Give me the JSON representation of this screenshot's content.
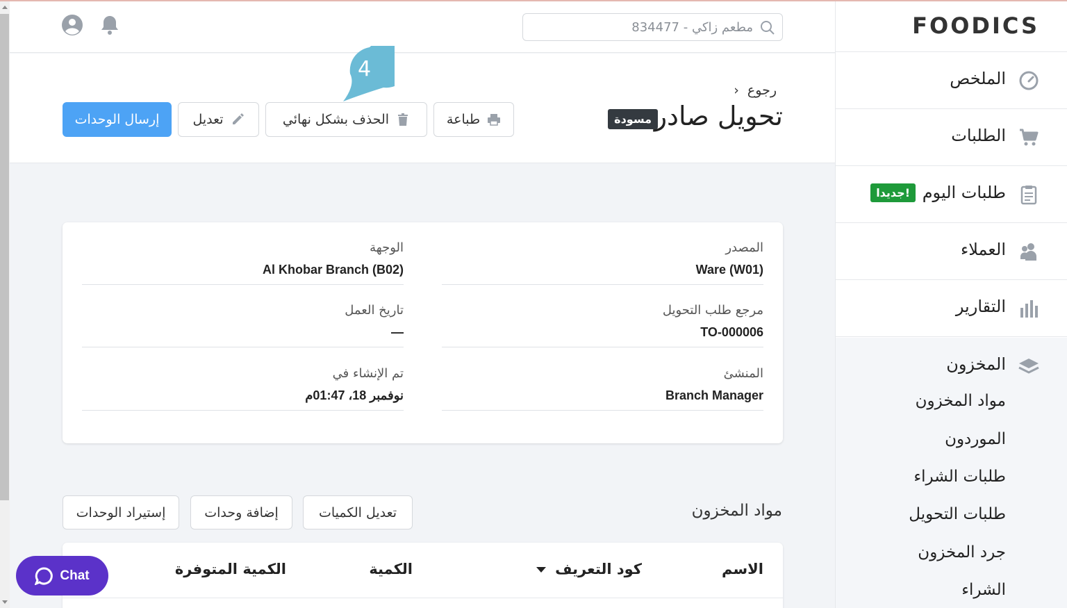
{
  "brand": {
    "logo": "FOODICS"
  },
  "header": {
    "search_text": "مطعم زاكي - 834477"
  },
  "sidebar": {
    "items": [
      {
        "label": "الملخص",
        "icon": "dashboard-gauge-icon"
      },
      {
        "label": "الطلبات",
        "icon": "cart-icon"
      },
      {
        "label": "طلبات اليوم",
        "icon": "clipboard-icon",
        "badge": "جديدا!"
      },
      {
        "label": "العملاء",
        "icon": "users-icon"
      },
      {
        "label": "التقارير",
        "icon": "bar-chart-icon"
      }
    ],
    "inventory": {
      "label": "المخزون",
      "icon": "layers-icon",
      "sub_items": [
        "مواد المخزون",
        "الموردون",
        "طلبات الشراء",
        "طلبات التحويل",
        "جرد المخزون",
        "الشراء"
      ]
    }
  },
  "page": {
    "back": "رجوع",
    "title": "تحويل صادر",
    "status_badge": "مسودة",
    "step_number": "4",
    "buttons": {
      "print": "طباعة",
      "delete": "الحذف بشكل نهائي",
      "edit": "تعديل",
      "send": "إرسال الوحدات"
    }
  },
  "details": {
    "source_label": "المصدر",
    "source_value": "Ware (W01)",
    "destination_label": "الوجهة",
    "destination_value": "Al Khobar Branch (B02)",
    "reference_label": "مرجع طلب التحويل",
    "reference_value": "TO-000006",
    "business_date_label": "تاريخ العمل",
    "business_date_value": "—",
    "creator_label": "المنشئ",
    "creator_value": "Branch Manager",
    "created_at_label": "تم الإنشاء في",
    "created_at_value": "نوفمبر 18، 01:47م"
  },
  "items": {
    "title": "مواد المخزون",
    "buttons": {
      "edit_quantities": "تعديل الكميات",
      "add_items": "إضافة وحدات",
      "import_items": "إستيراد الوحدات"
    },
    "columns": {
      "name": "الاسم",
      "sku": "كود التعريف",
      "quantity": "الكمية",
      "available_quantity": "الكمية المتوفرة"
    }
  },
  "chat": {
    "label": "Chat"
  },
  "colors": {
    "primary": "#4da3f5",
    "new_badge": "#1e9a3a",
    "draft_badge": "#343a40",
    "chat": "#5b32c9",
    "step_marker": "#6bbbd6"
  }
}
